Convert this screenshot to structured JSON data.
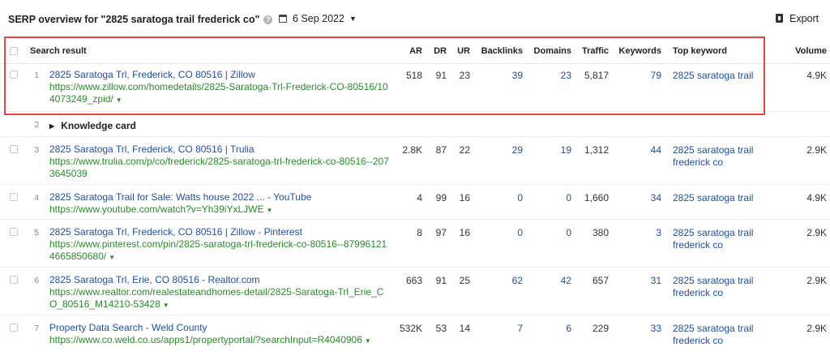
{
  "header": {
    "title": "SERP overview for \"2825 saratoga trail frederick co\"",
    "help_icon": "?",
    "date": "6 Sep 2022",
    "export_label": "Export"
  },
  "columns": {
    "result": "Search result",
    "ar": "AR",
    "dr": "DR",
    "ur": "UR",
    "backlinks": "Backlinks",
    "domains": "Domains",
    "traffic": "Traffic",
    "keywords": "Keywords",
    "top_keyword": "Top keyword",
    "volume": "Volume"
  },
  "rows": [
    {
      "index": "1",
      "title": "2825 Saratoga Trl, Frederick, CO 80516 | Zillow",
      "url": "https://www.zillow.com/homedetails/2825-Saratoga-Trl-Frederick-CO-80516/104073249_zpid/",
      "ar": "518",
      "dr": "91",
      "ur": "23",
      "backlinks": "39",
      "domains": "23",
      "traffic": "5,817",
      "keywords": "79",
      "top_keyword": "2825 saratoga trail",
      "volume": "4.9K"
    },
    {
      "index": "2",
      "knowledge": "Knowledge card"
    },
    {
      "index": "3",
      "title": "2825 Saratoga Trl, Frederick, CO 80516 | Trulia",
      "url": "https://www.trulia.com/p/co/frederick/2825-saratoga-trl-frederick-co-80516--2073645039",
      "ar": "2.8K",
      "dr": "87",
      "ur": "22",
      "backlinks": "29",
      "domains": "19",
      "traffic": "1,312",
      "keywords": "44",
      "top_keyword": "2825 saratoga trail frederick co",
      "volume": "2.9K"
    },
    {
      "index": "4",
      "title": "2825 Saratoga Trail for Sale: Watts house 2022 ... - YouTube",
      "url": "https://www.youtube.com/watch?v=Yh39iYxLJWE",
      "ar": "4",
      "dr": "99",
      "ur": "16",
      "backlinks": "0",
      "domains": "0",
      "traffic": "1,660",
      "keywords": "34",
      "top_keyword": "2825 saratoga trail",
      "volume": "4.9K"
    },
    {
      "index": "5",
      "title": "2825 Saratoga Trl, Frederick, CO 80516 | Zillow - Pinterest",
      "url": "https://www.pinterest.com/pin/2825-saratoga-trl-frederick-co-80516--879961214665850680/",
      "ar": "8",
      "dr": "97",
      "ur": "16",
      "backlinks": "0",
      "domains": "0",
      "traffic": "380",
      "keywords": "3",
      "top_keyword": "2825 saratoga trail frederick co",
      "volume": "2.9K"
    },
    {
      "index": "6",
      "title": "2825 Saratoga Trl, Erie, CO 80516 - Realtor.com",
      "url": "https://www.realtor.com/realestateandhomes-detail/2825-Saratoga-Trl_Erie_CO_80516_M14210-53428",
      "ar": "663",
      "dr": "91",
      "ur": "25",
      "backlinks": "62",
      "domains": "42",
      "traffic": "657",
      "keywords": "31",
      "top_keyword": "2825 saratoga trail frederick co",
      "volume": "2.9K"
    },
    {
      "index": "7",
      "title": "Property Data Search - Weld County",
      "url": "https://www.co.weld.co.us/apps1/propertyportal/?searchInput=R4040906",
      "ar": "532K",
      "dr": "53",
      "ur": "14",
      "backlinks": "7",
      "domains": "6",
      "traffic": "229",
      "keywords": "33",
      "top_keyword": "2825 saratoga trail frederick co",
      "volume": "2.9K"
    }
  ],
  "colors": {
    "link": "#1f4fa8",
    "url": "#2b8a2b",
    "highlight": "#e8473b"
  }
}
